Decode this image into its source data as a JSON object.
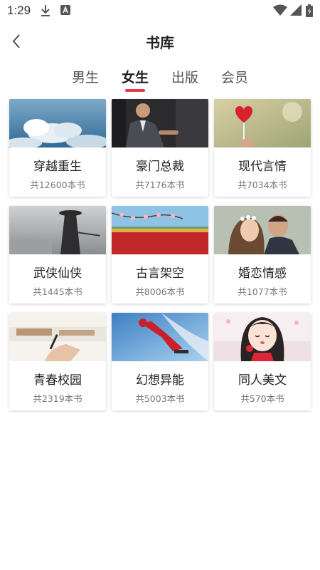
{
  "status_bar": {
    "time": "1:29"
  },
  "header": {
    "title": "书库"
  },
  "tabs": [
    "男生",
    "女生",
    "出版",
    "会员"
  ],
  "active_tab": "女生",
  "categories": [
    {
      "name": "穿越重生",
      "count": "共12600本书",
      "image": "sky-clouds"
    },
    {
      "name": "豪门总裁",
      "count": "共7176本书",
      "image": "businessman"
    },
    {
      "name": "现代言情",
      "count": "共7034本书",
      "image": "heart-lollipop"
    },
    {
      "name": "武侠仙侠",
      "count": "共1445本书",
      "image": "swordsman"
    },
    {
      "name": "古言架空",
      "count": "共8006本书",
      "image": "palace-wall"
    },
    {
      "name": "婚恋情感",
      "count": "共1077本书",
      "image": "couple"
    },
    {
      "name": "青春校园",
      "count": "共2319本书",
      "image": "classroom-writing"
    },
    {
      "name": "幻想异能",
      "count": "共5003本书",
      "image": "flying-hero"
    },
    {
      "name": "同人美文",
      "count": "共570本书",
      "image": "anime-girl"
    }
  ]
}
